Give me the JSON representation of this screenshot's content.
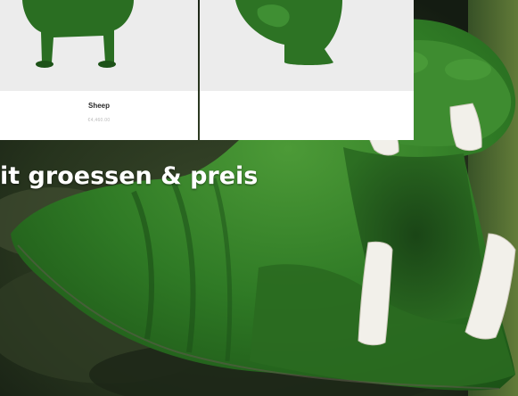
{
  "cards": [
    {
      "title": "Sheep",
      "price": "€4,460.00"
    }
  ],
  "headline": "it groessen & preis",
  "colors": {
    "grass_dark": "#1f5a19",
    "grass_mid": "#2f7a25",
    "grass_light": "#4c9a37",
    "tusk": "#f2f0ea",
    "background": "#1e2a1a"
  }
}
